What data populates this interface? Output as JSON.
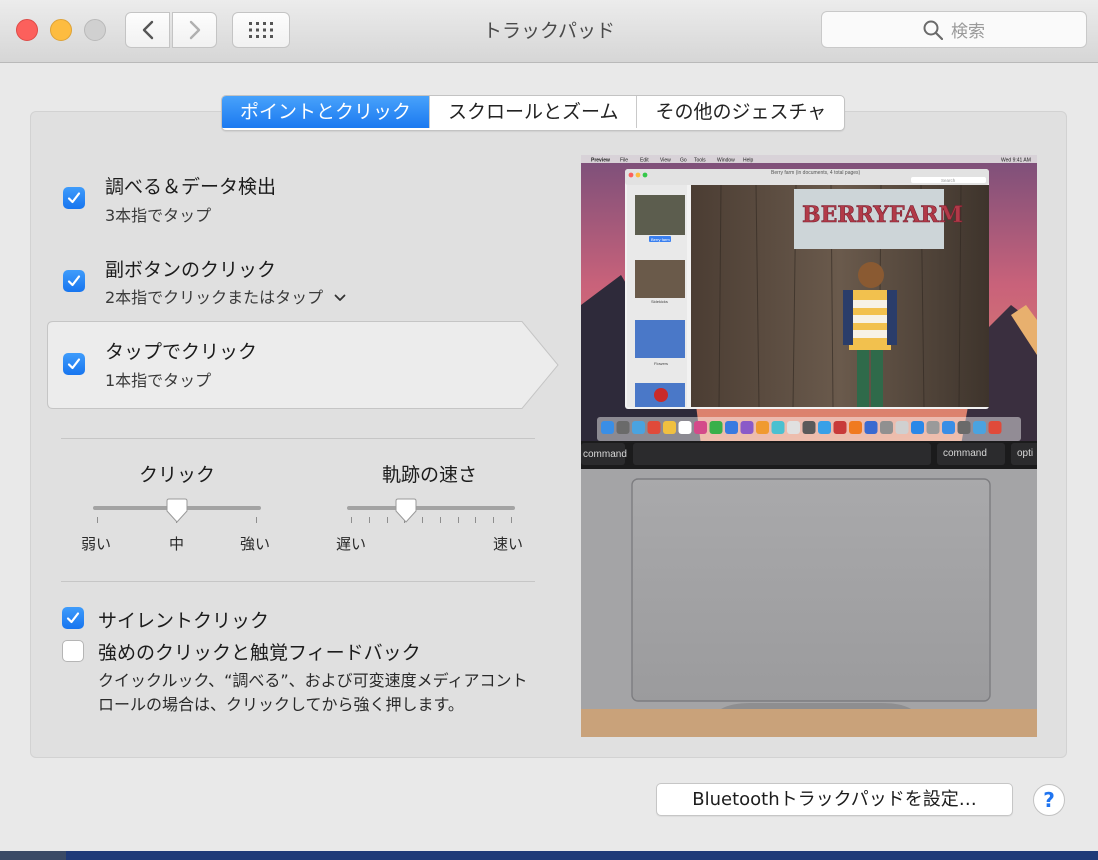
{
  "window": {
    "title": "トラックパッド"
  },
  "toolbar": {
    "search_placeholder": "検索"
  },
  "tabs": [
    {
      "label": "ポイントとクリック",
      "active": true
    },
    {
      "label": "スクロールとズーム",
      "active": false
    },
    {
      "label": "その他のジェスチャ",
      "active": false
    }
  ],
  "options": [
    {
      "title": "調べる＆データ検出",
      "subtitle": "3本指でタップ",
      "checked": true
    },
    {
      "title": "副ボタンのクリック",
      "subtitle": "2本指でクリックまたはタップ",
      "checked": true,
      "has_menu": true
    },
    {
      "title": "タップでクリック",
      "subtitle": "1本指でタップ",
      "checked": true,
      "selected": true
    }
  ],
  "sliders": {
    "click": {
      "title": "クリック",
      "labels": [
        "弱い",
        "中",
        "強い"
      ],
      "value": 0.5
    },
    "tracking": {
      "title": "軌跡の速さ",
      "labels": [
        "遅い",
        "速い"
      ],
      "value": 0.35
    }
  },
  "bottom_options": [
    {
      "label": "サイレントクリック",
      "checked": true
    },
    {
      "label": "強めのクリックと触覚フィードバック",
      "checked": false
    }
  ],
  "description": "クイックルック、“調べる”、および可変速度メディアコントロールの場合は、クリックしてから強く押します。",
  "preview": {
    "menubar": [
      "Preview",
      "File",
      "Edit",
      "View",
      "Go",
      "Tools",
      "Window",
      "Help"
    ],
    "clock": "Wed 9:41 AM",
    "doc_title": "Berry farm (in documents, 4 total pages)",
    "search_placeholder": "Search",
    "sign_text": "BERRYFARM",
    "thumbnails": [
      "Berry farm",
      "Sidekicks",
      "Flowers"
    ],
    "key_left": "command",
    "key_right": "command",
    "key_opt": "opti"
  },
  "footer": {
    "bluetooth_button": "Bluetoothトラックパッドを設定…",
    "help": "?"
  },
  "colors": {
    "accent": "#1b79f0",
    "checkbox": "#2a86f5"
  }
}
